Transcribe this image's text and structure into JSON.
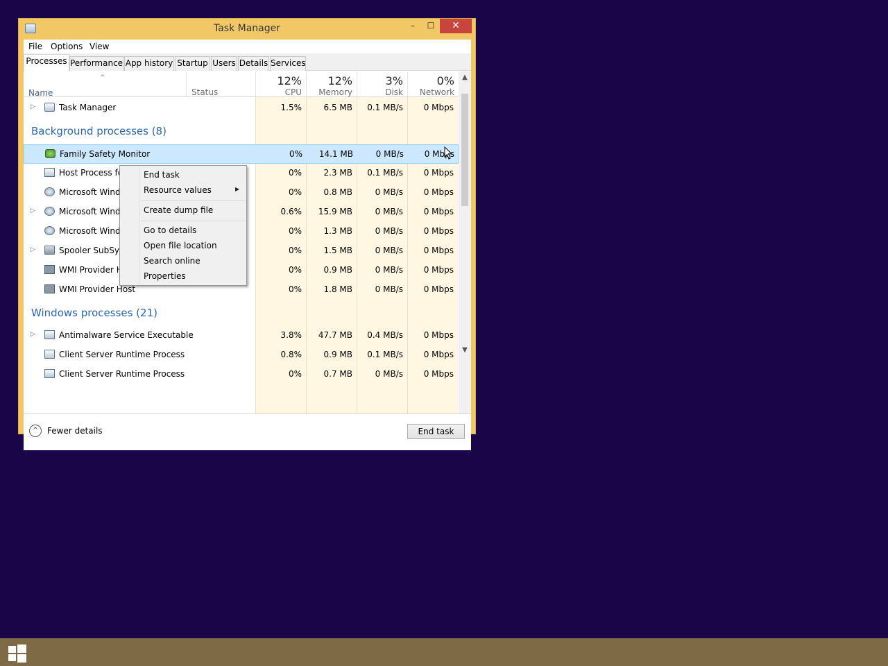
{
  "window": {
    "title": "Task Manager",
    "minimize": "–",
    "maximize": "☐",
    "close": "✕"
  },
  "menu": [
    "File",
    "Options",
    "View"
  ],
  "tabs": [
    "Processes",
    "Performance",
    "App history",
    "Startup",
    "Users",
    "Details",
    "Services"
  ],
  "active_tab": "Processes",
  "columns": {
    "name": "Name",
    "status": "Status",
    "cpu": {
      "pct": "12%",
      "label": "CPU"
    },
    "memory": {
      "pct": "12%",
      "label": "Memory"
    },
    "disk": {
      "pct": "3%",
      "label": "Disk"
    },
    "network": {
      "pct": "0%",
      "label": "Network"
    }
  },
  "rows": [
    {
      "name": "Task Manager",
      "cpu": "1.5%",
      "mem": "6.5 MB",
      "disk": "0.1 MB/s",
      "net": "0 Mbps",
      "expandable": true,
      "icon": "task-manager-icon"
    },
    {
      "name": "Family Safety Monitor",
      "cpu": "0%",
      "mem": "14.1 MB",
      "disk": "0 MB/s",
      "net": "0 Mbps",
      "selected": true,
      "icon": "family-safety-icon"
    },
    {
      "name": "Host Process for",
      "cpu": "0%",
      "mem": "2.3 MB",
      "disk": "0.1 MB/s",
      "net": "0 Mbps",
      "icon": "app-window-icon"
    },
    {
      "name": "Microsoft Windo",
      "cpu": "0%",
      "mem": "0.8 MB",
      "disk": "0 MB/s",
      "net": "0 Mbps",
      "icon": "service-icon"
    },
    {
      "name": "Microsoft Windo",
      "cpu": "0.6%",
      "mem": "15.9 MB",
      "disk": "0 MB/s",
      "net": "0 Mbps",
      "expandable": true,
      "icon": "service-icon"
    },
    {
      "name": "Microsoft Windo",
      "cpu": "0%",
      "mem": "1.3 MB",
      "disk": "0 MB/s",
      "net": "0 Mbps",
      "icon": "service-icon"
    },
    {
      "name": "Spooler SubSyste",
      "cpu": "0%",
      "mem": "1.5 MB",
      "disk": "0 MB/s",
      "net": "0 Mbps",
      "expandable": true,
      "icon": "printer-icon"
    },
    {
      "name": "WMI Provider Ho",
      "cpu": "0%",
      "mem": "0.9 MB",
      "disk": "0 MB/s",
      "net": "0 Mbps",
      "icon": "wmi-icon"
    },
    {
      "name": "WMI Provider Host",
      "cpu": "0%",
      "mem": "1.8 MB",
      "disk": "0 MB/s",
      "net": "0 Mbps",
      "icon": "wmi-icon"
    },
    {
      "name": "Antimalware Service Executable",
      "cpu": "3.8%",
      "mem": "47.7 MB",
      "disk": "0.4 MB/s",
      "net": "0 Mbps",
      "expandable": true,
      "icon": "app-window-icon"
    },
    {
      "name": "Client Server Runtime Process",
      "cpu": "0.8%",
      "mem": "0.9 MB",
      "disk": "0.1 MB/s",
      "net": "0 Mbps",
      "icon": "app-window-icon"
    },
    {
      "name": "Client Server Runtime Process",
      "cpu": "0%",
      "mem": "0.7 MB",
      "disk": "0 MB/s",
      "net": "0 Mbps",
      "icon": "app-window-icon"
    }
  ],
  "groups": {
    "background": "Background processes (8)",
    "windows": "Windows processes (21)"
  },
  "context_menu": [
    "End task",
    "Resource values",
    "Create dump file",
    "Go to details",
    "Open file location",
    "Search online",
    "Properties"
  ],
  "footer": {
    "fewer_details": "Fewer details",
    "end_task": "End task"
  },
  "colors": {
    "frame": "#f2c766",
    "close": "#c7453c",
    "desktop": "#1a0548",
    "taskbar": "#7e6a45",
    "group_text": "#2a66ae",
    "selection": "#cce8ff"
  }
}
